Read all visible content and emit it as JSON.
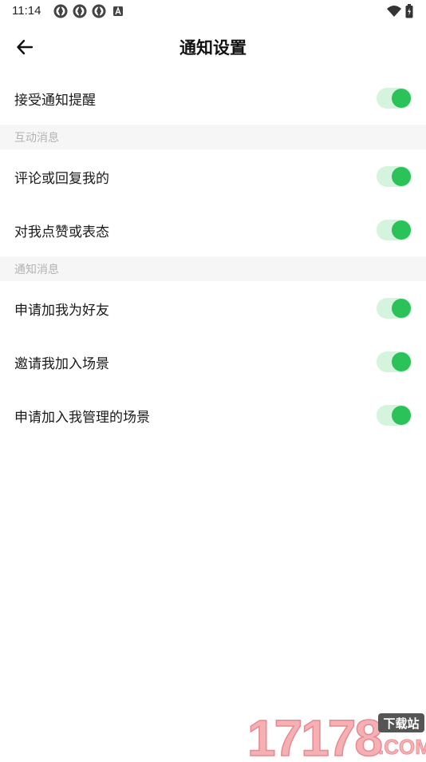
{
  "status_bar": {
    "time": "11:14",
    "icons": [
      "sync-icon",
      "sync-icon",
      "sync-icon",
      "a-badge-icon",
      "wifi-icon",
      "battery-icon"
    ]
  },
  "header": {
    "title": "通知设置",
    "back_icon": "arrow-left-icon"
  },
  "rows": [
    {
      "label": "接受通知提醒",
      "enabled": true
    }
  ],
  "sections": [
    {
      "title": "互动消息",
      "items": [
        {
          "label": "评论或回复我的",
          "enabled": true
        },
        {
          "label": "对我点赞或表态",
          "enabled": true
        }
      ]
    },
    {
      "title": "通知消息",
      "items": [
        {
          "label": "申请加我为好友",
          "enabled": true
        },
        {
          "label": "邀请我加入场景",
          "enabled": true
        },
        {
          "label": "申请加入我管理的场景",
          "enabled": true
        }
      ]
    }
  ],
  "watermark": {
    "number": "17178",
    "tag": "下载站",
    "suffix": ".COM"
  },
  "colors": {
    "toggle_on": "#2bc25a",
    "toggle_track": "#d5f4dd",
    "section_bg": "#f6f6f6",
    "watermark": "#f29aa0"
  }
}
